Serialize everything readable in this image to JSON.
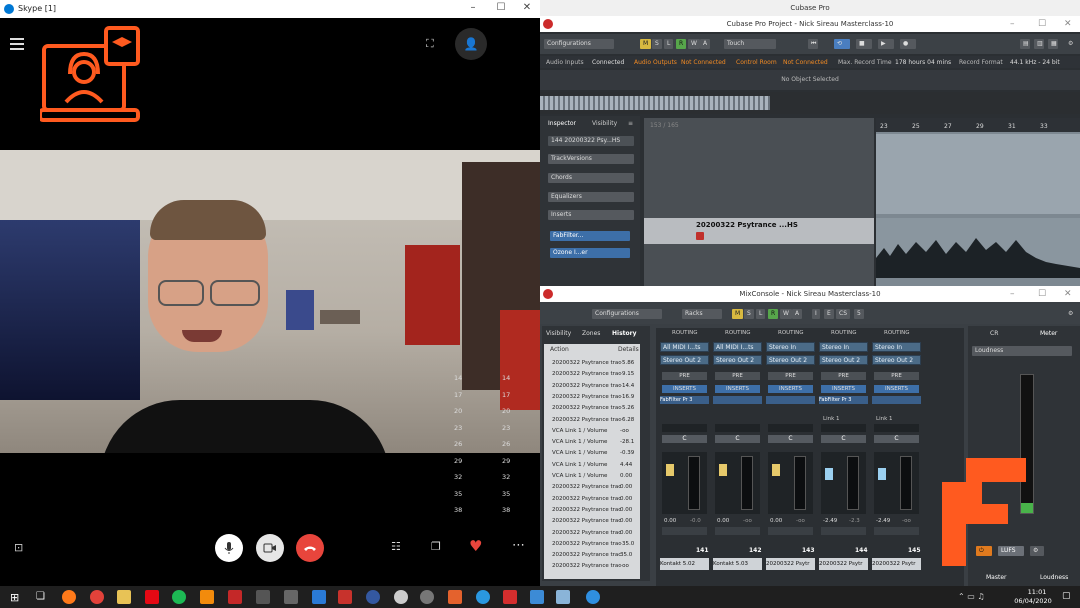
{
  "skype": {
    "title": "Skype [1]"
  },
  "cubase": {
    "app_title": "Cubase Pro",
    "project_title": "Cubase Pro Project - Nick Sireau Masterclass-10",
    "toolbar": {
      "configurations": "Configurations",
      "modes": [
        "M",
        "S",
        "L",
        "R",
        "W",
        "A"
      ],
      "touch": "Touch"
    },
    "status": {
      "audio_inputs_label": "Audio Inputs",
      "audio_inputs_value": "Connected",
      "audio_outputs_label": "Audio Outputs",
      "audio_outputs_value": "Not Connected",
      "control_room_label": "Control Room",
      "control_room_value": "Not Connected",
      "max_record_label": "Max. Record Time",
      "max_record_value": "178 hours 04 mins",
      "record_format_label": "Record Format",
      "record_format_value": "44.1 kHz - 24 bit"
    },
    "no_object": "No Object Selected",
    "inspector": {
      "tab_inspector": "Inspector",
      "tab_visibility": "Visibility",
      "track_number": "144",
      "track_name": "20200322 Psy...HS",
      "sections": [
        "TrackVersions",
        "Chords",
        "Equalizers",
        "Inserts"
      ],
      "inserts": [
        "FabFilter...",
        "Ozone I...er"
      ]
    },
    "tracklist": {
      "count": "153 / 165",
      "track_name": "20200322 Psytrance ...HS"
    },
    "ruler": [
      "23",
      "25",
      "27",
      "29",
      "31",
      "33"
    ]
  },
  "mixconsole": {
    "title": "MixConsole - Nick Sireau Masterclass-10",
    "configurations": "Configurations",
    "racks": "Racks",
    "modes": [
      "M",
      "S",
      "L",
      "R",
      "W",
      "A",
      "I",
      "E",
      "CS",
      "5"
    ],
    "left_tabs": [
      "Visibility",
      "Zones",
      "History"
    ],
    "history_headers": [
      "Action",
      "Details"
    ],
    "history_rows": [
      [
        "20200322 Psytrance trac",
        "-5.86"
      ],
      [
        "20200322 Psytrance trac",
        "-9.15"
      ],
      [
        "20200322 Psytrance trac",
        "-14.4"
      ],
      [
        "20200322 Psytrance trac",
        "-16.9"
      ],
      [
        "20200322 Psytrance trac",
        "-5.26"
      ],
      [
        "20200322 Psytrance trac",
        "-6.28"
      ],
      [
        "VCA Link 1 / Volume",
        "-oo"
      ],
      [
        "VCA Link 1 / Volume",
        "-28.1"
      ],
      [
        "VCA Link 1 / Volume",
        "-0.39"
      ],
      [
        "VCA Link 1 / Volume",
        "4.44"
      ],
      [
        "VCA Link 1 / Volume",
        "0.00"
      ],
      [
        "20200322 Psytrance trac",
        "0.00"
      ],
      [
        "20200322 Psytrance trac",
        "0.00"
      ],
      [
        "20200322 Psytrance trac",
        "0.00"
      ],
      [
        "20200322 Psytrance trac",
        "0.00"
      ],
      [
        "20200322 Psytrance trac",
        "0.00"
      ],
      [
        "20200322 Psytrance trac",
        "-35.0"
      ],
      [
        "20200322 Psytrance trac",
        "35.0"
      ],
      [
        "20200322 Psytrance trac",
        "-oo"
      ]
    ],
    "strips": [
      {
        "routing": "ROUTING",
        "in": "All MIDI I...ts",
        "out": "Stereo Out 2",
        "pre": "PRE",
        "inserts": "INSERTS",
        "insert_slot": "FabFilter Pr 3",
        "pan": "C",
        "vol": "0.00",
        "peak": "-0.0",
        "num": "141",
        "name": "Kontakt 5.02"
      },
      {
        "routing": "ROUTING",
        "in": "All MIDI I...ts",
        "out": "Stereo Out 2",
        "pre": "PRE",
        "inserts": "INSERTS",
        "insert_slot": "",
        "pan": "C",
        "vol": "0.00",
        "peak": "-oo",
        "num": "142",
        "name": "Kontakt 5.03"
      },
      {
        "routing": "ROUTING",
        "in": "Stereo In",
        "out": "Stereo Out 2",
        "pre": "PRE",
        "inserts": "INSERTS",
        "insert_slot": "",
        "pan": "C",
        "vol": "0.00",
        "peak": "-oo",
        "num": "143",
        "name": "20200322 Psytr"
      },
      {
        "routing": "ROUTING",
        "in": "Stereo In",
        "out": "Stereo Out 2",
        "pre": "PRE",
        "inserts": "INSERTS",
        "insert_slot": "FabFilter Pr 3",
        "pan": "C",
        "vol": "-2.49",
        "peak": "-2.3",
        "num": "144",
        "name": "20200322 Psytr",
        "link": "Link 1"
      },
      {
        "routing": "ROUTING",
        "in": "Stereo In",
        "out": "Stereo Out 2",
        "pre": "PRE",
        "inserts": "INSERTS",
        "insert_slot": "",
        "pan": "C",
        "vol": "-2.49",
        "peak": "-oo",
        "num": "145",
        "name": "20200322 Psytr",
        "link": "Link 1"
      }
    ],
    "meter_tabs": [
      "CR",
      "Meter"
    ],
    "loudness": "Loudness",
    "scale": [
      "14",
      "17",
      "20",
      "23",
      "26",
      "29",
      "32",
      "35",
      "38"
    ],
    "lufs": "LUFS",
    "bottom_tabs": [
      "Master",
      "Loudness"
    ]
  },
  "taskbar": {
    "time": "11:01",
    "date": "06/04/2020"
  },
  "colors": {
    "skype_accent": "#ff5a1f",
    "end_call": "#e8453c",
    "cubase_orange": "#f08a24",
    "track_selected": "#4b6b87"
  }
}
